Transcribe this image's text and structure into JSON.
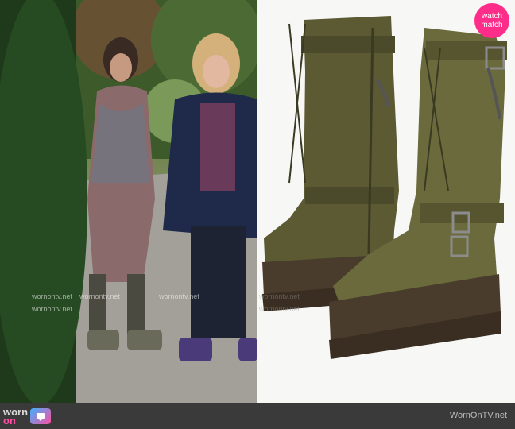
{
  "badge": {
    "line1": "watch",
    "line2": "match"
  },
  "footer": {
    "brand_worn": "worn",
    "brand_on": "on",
    "domain": "WornOnTV.net"
  },
  "watermarks": {
    "left": [
      "wornontv.net",
      "wornontv.net",
      "wornontv.net",
      "wornontv.net"
    ],
    "right": [
      "wornontv.net",
      "wornontv.net"
    ]
  },
  "icons": {
    "tv": "tv-icon"
  },
  "colors": {
    "badge": "#ff2d8a",
    "footer": "#3a3a3a",
    "boot": "#5b5a33"
  }
}
